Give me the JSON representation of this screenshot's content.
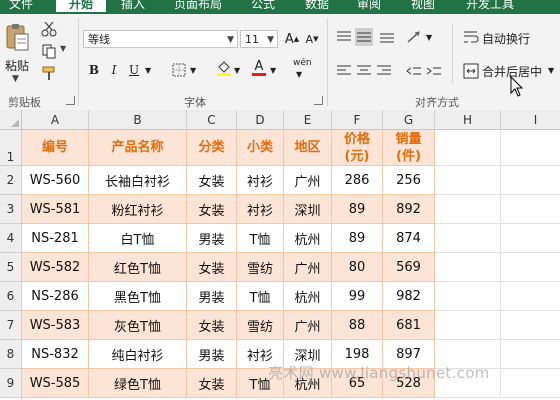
{
  "ribbon_tabs": [
    "文件",
    "开始",
    "插入",
    "页面布局",
    "公式",
    "数据",
    "审阅",
    "视图",
    "开发工具"
  ],
  "clipboard": {
    "paste_label": "粘贴",
    "group_label": "剪贴板"
  },
  "font": {
    "name": "等线",
    "size": "11",
    "group_label": "字体",
    "bold": "B",
    "italic": "I",
    "underline": "U",
    "grow": "A",
    "shrink": "A",
    "font_color_glyph": "A",
    "phonetic_glyph": "wén"
  },
  "alignment": {
    "wrap_text": "自动换行",
    "merge_center": "合并后居中",
    "group_label": "对齐方式"
  },
  "columns": [
    "A",
    "B",
    "C",
    "D",
    "E",
    "F",
    "G",
    "H",
    "I"
  ],
  "rows": [
    "1",
    "2",
    "3",
    "4",
    "5",
    "6",
    "7",
    "8",
    "9"
  ],
  "table": {
    "headers": [
      "编号",
      "产品名称",
      "分类",
      "小类",
      "地区",
      "价格\n(元)",
      "销量\n(件)"
    ],
    "rows": [
      [
        "WS-560",
        "长袖白衬衫",
        "女装",
        "衬衫",
        "广州",
        "286",
        "256"
      ],
      [
        "WS-581",
        "粉红衬衫",
        "女装",
        "衬衫",
        "深圳",
        "89",
        "892"
      ],
      [
        "NS-281",
        "白T恤",
        "男装",
        "T恤",
        "杭州",
        "89",
        "874"
      ],
      [
        "WS-582",
        "红色T恤",
        "女装",
        "雪纺",
        "广州",
        "80",
        "569"
      ],
      [
        "NS-286",
        "黑色T恤",
        "男装",
        "T恤",
        "杭州",
        "99",
        "982"
      ],
      [
        "WS-583",
        "灰色T恤",
        "女装",
        "雪纺",
        "广州",
        "88",
        "681"
      ],
      [
        "NS-832",
        "纯白衬衫",
        "男装",
        "衬衫",
        "深圳",
        "198",
        "897"
      ],
      [
        "WS-585",
        "绿色T恤",
        "女装",
        "T恤",
        "杭州",
        "65",
        "528"
      ]
    ]
  },
  "colors": {
    "accent": "#217346",
    "header_text": "#e46c0a",
    "band": "#fce4d6",
    "border": "#f3c8a7"
  },
  "watermark": "亮术网 www.liangshunet.com"
}
